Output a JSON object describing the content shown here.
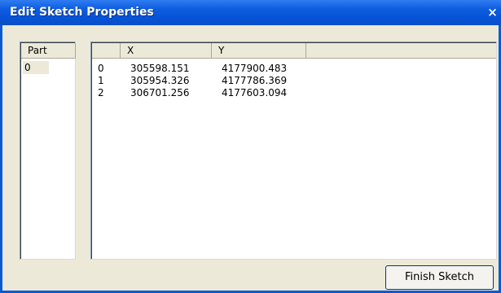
{
  "window": {
    "title": "Edit Sketch Properties",
    "close_label": "×"
  },
  "parts": {
    "header": "Part",
    "items": [
      "0"
    ]
  },
  "coords": {
    "headers": [
      "",
      "X",
      "Y",
      ""
    ],
    "rows": [
      {
        "index": "0",
        "x": "305598.151",
        "y": "4177900.483"
      },
      {
        "index": "1",
        "x": "305954.326",
        "y": "4177786.369"
      },
      {
        "index": "2",
        "x": "306701.256",
        "y": "4177603.094"
      }
    ]
  },
  "footer": {
    "finish_label": "Finish Sketch"
  }
}
